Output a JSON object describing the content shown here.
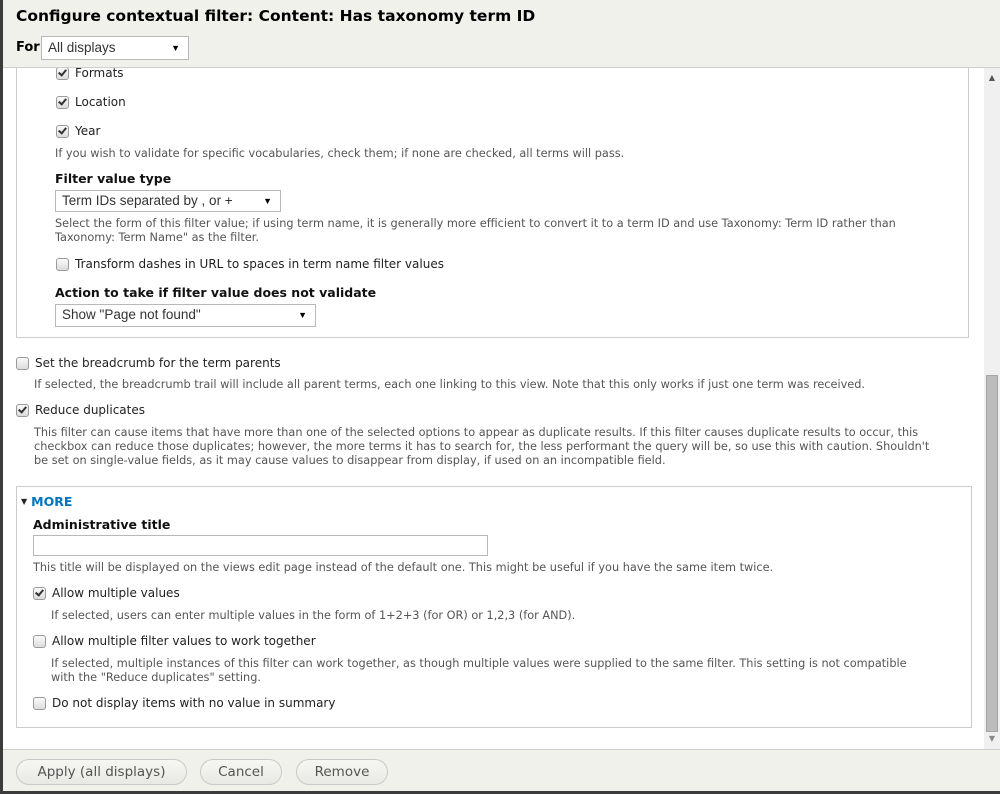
{
  "dialog": {
    "title": "Configure contextual filter: Content: Has taxonomy term ID",
    "for_label": "For",
    "for_select": {
      "value": "All displays"
    }
  },
  "vocabularies": {
    "items": [
      {
        "label": "Formats",
        "checked": true
      },
      {
        "label": "Location",
        "checked": true
      },
      {
        "label": "Year",
        "checked": true
      }
    ],
    "description": "If you wish to validate for specific vocabularies, check them; if none are checked, all terms will pass."
  },
  "filter_value_type": {
    "label": "Filter value type",
    "value": "Term IDs separated by , or +",
    "description_line1": "Select the form of this filter value; if using term name, it is generally more efficient to convert it to a term ID and use Taxonomy: Term ID rather than",
    "description_line2": "Taxonomy: Term Name\" as the filter."
  },
  "transform_dashes": {
    "label": "Transform dashes in URL to spaces in term name filter values",
    "checked": false
  },
  "fail_action": {
    "label": "Action to take if filter value does not validate",
    "value": "Show \"Page not found\""
  },
  "breadcrumb": {
    "label": "Set the breadcrumb for the term parents",
    "checked": false,
    "description": "If selected, the breadcrumb trail will include all parent terms, each one linking to this view. Note that this only works if just one term was received."
  },
  "reduce_duplicates": {
    "label": "Reduce duplicates",
    "checked": true,
    "description_line1": "This filter can cause items that have more than one of the selected options to appear as duplicate results. If this filter causes duplicate results to occur, this",
    "description_line2": "checkbox can reduce those duplicates; however, the more terms it has to search for, the less performant the query will be, so use this with caution. Shouldn't",
    "description_line3": "be set on single-value fields, as it may cause values to disappear from display, if used on an incompatible field."
  },
  "more": {
    "toggle_label": "MORE",
    "admin_title": {
      "label": "Administrative title",
      "value": "",
      "description": "This title will be displayed on the views edit page instead of the default one. This might be useful if you have the same item twice."
    },
    "allow_multiple": {
      "label": "Allow multiple values",
      "checked": true,
      "description": "If selected, users can enter multiple values in the form of 1+2+3 (for OR) or 1,2,3 (for AND)."
    },
    "work_together": {
      "label": "Allow multiple filter values to work together",
      "checked": false,
      "description_line1": "If selected, multiple instances of this filter can work together, as though multiple values were supplied to the same filter. This setting is not compatible",
      "description_line2": "with the \"Reduce duplicates\" setting."
    },
    "no_empty": {
      "label": "Do not display items with no value in summary",
      "checked": false
    }
  },
  "footer": {
    "apply_label": "Apply (all displays)",
    "cancel_label": "Cancel",
    "remove_label": "Remove"
  },
  "icons": {
    "dropdown": "▼",
    "collapse": "▼",
    "scroll_up": "▲",
    "scroll_down": "▼"
  }
}
